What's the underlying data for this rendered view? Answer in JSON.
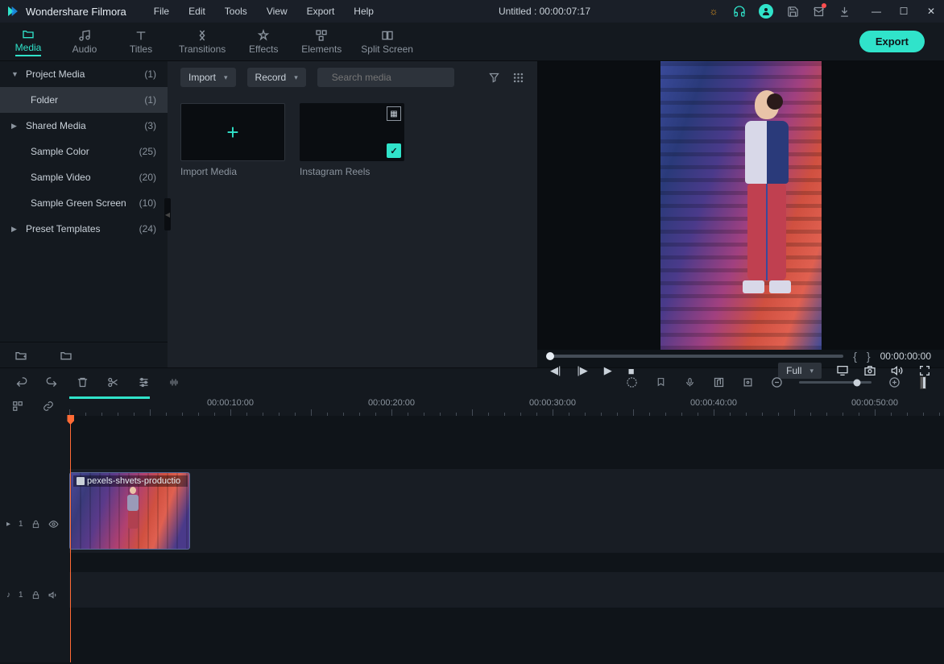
{
  "app": {
    "name": "Wondershare Filmora",
    "title": "Untitled : 00:00:07:17"
  },
  "menu": [
    "File",
    "Edit",
    "Tools",
    "View",
    "Export",
    "Help"
  ],
  "tabs": [
    {
      "id": "media",
      "label": "Media"
    },
    {
      "id": "audio",
      "label": "Audio"
    },
    {
      "id": "titles",
      "label": "Titles"
    },
    {
      "id": "transitions",
      "label": "Transitions"
    },
    {
      "id": "effects",
      "label": "Effects"
    },
    {
      "id": "elements",
      "label": "Elements"
    },
    {
      "id": "split",
      "label": "Split Screen"
    }
  ],
  "export_label": "Export",
  "sidebar": {
    "items": [
      {
        "name": "Project Media",
        "count": "(1)",
        "expand": "▼"
      },
      {
        "name": "Folder",
        "count": "(1)",
        "child": true,
        "selected": true
      },
      {
        "name": "Shared Media",
        "count": "(3)",
        "expand": "▶"
      },
      {
        "name": "Sample Color",
        "count": "(25)"
      },
      {
        "name": "Sample Video",
        "count": "(20)"
      },
      {
        "name": "Sample Green Screen",
        "count": "(10)"
      },
      {
        "name": "Preset Templates",
        "count": "(24)",
        "expand": "▶"
      }
    ]
  },
  "media_toolbar": {
    "import": "Import",
    "record": "Record",
    "search_placeholder": "Search media"
  },
  "tiles": {
    "import_label": "Import Media",
    "reel_label": "Instagram Reels"
  },
  "preview": {
    "time": "00:00:00:00",
    "quality": "Full"
  },
  "ruler_labels": [
    "00:00:10:00",
    "00:00:20:00",
    "00:00:30:00",
    "00:00:40:00",
    "00:00:50:00"
  ],
  "tracks": {
    "video": {
      "label": "1"
    },
    "audio": {
      "label": "1"
    },
    "clip_name": "pexels-shvets-productio"
  }
}
